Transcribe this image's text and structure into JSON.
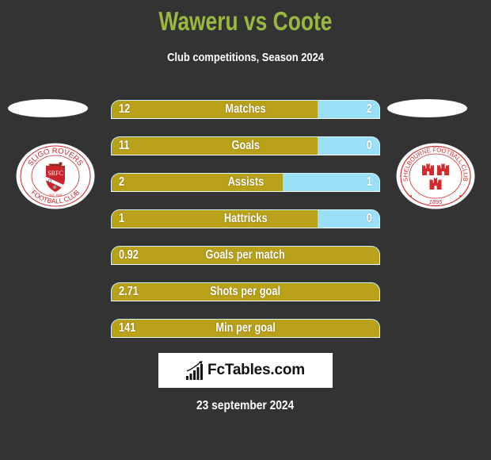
{
  "chart_data": {
    "type": "bar",
    "orientation": "horizontal-comparison",
    "title": "Waweru vs Coote",
    "subtitle": "Club competitions, Season 2024",
    "xlabel": "",
    "ylabel": "",
    "grid": false,
    "legend": "none",
    "categories": [
      "Matches",
      "Goals",
      "Assists",
      "Hattricks",
      "Goals per match",
      "Shots per goal",
      "Min per goal"
    ],
    "series": [
      {
        "name": "Waweru",
        "side": "left",
        "color": "#b9a11a",
        "values": [
          12,
          11,
          2,
          1,
          0.92,
          2.71,
          141
        ]
      },
      {
        "name": "Coote",
        "side": "right",
        "color": "#9ae1f8",
        "values": [
          2,
          0,
          1,
          0,
          null,
          null,
          null
        ]
      }
    ],
    "left_share": [
      0.77,
      0.77,
      0.64,
      0.77,
      1,
      1,
      1
    ]
  },
  "teams": {
    "left": {
      "logo": {
        "top_text": "SLIGO ROVERS",
        "bottom_text": "FOOTBALL CLUB",
        "shield_text": "SRFC",
        "est_text": "EST. 1928"
      }
    },
    "right": {
      "logo": {
        "ring_text": "SHELBOURNE FOOTBALL CLUB",
        "year_text": "1895"
      }
    }
  },
  "colors": {
    "background": "#333333",
    "title": "#9ab83f",
    "text": "#ffffff",
    "crest_red": "#c8242b"
  },
  "branding": {
    "site": "FcTables.com",
    "icon": "bar-chart-icon"
  },
  "footer": {
    "date": "23 september 2024"
  }
}
